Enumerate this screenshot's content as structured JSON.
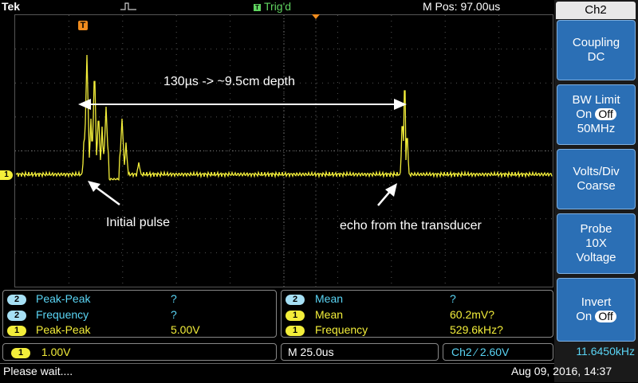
{
  "header": {
    "brand": "Tek",
    "trigger_state": "Trig'd",
    "trigger_icon_letter": "T",
    "mpos": "M Pos: 97.00us"
  },
  "menu": {
    "title": "Ch2",
    "buttons": [
      {
        "line1": "Coupling",
        "line2": "DC"
      },
      {
        "line1": "BW Limit",
        "on": "On",
        "off": "Off",
        "line3": "50MHz"
      },
      {
        "line1": "Volts/Div",
        "line2": "Coarse"
      },
      {
        "line1": "Probe",
        "line2": "10X",
        "line3": "Voltage"
      },
      {
        "line1": "Invert",
        "on": "On",
        "off": "Off"
      }
    ]
  },
  "annotations": {
    "depth": "130µs -> ~9.5cm depth",
    "initial": "Initial pulse",
    "echo": "echo from the transducer"
  },
  "channel_marker": "1",
  "trigger_marker": "T",
  "measurements_left": [
    {
      "ch": "2",
      "name": "Peak-Peak",
      "value": "?"
    },
    {
      "ch": "2",
      "name": "Frequency",
      "value": "?"
    },
    {
      "ch": "1",
      "name": "Peak-Peak",
      "value": "5.00V"
    }
  ],
  "measurements_right": [
    {
      "ch": "2",
      "name": "Mean",
      "value": "?"
    },
    {
      "ch": "1",
      "name": "Mean",
      "value": "60.2mV?"
    },
    {
      "ch": "1",
      "name": "Frequency",
      "value": "529.6kHz?"
    }
  ],
  "settings": {
    "ch1_badge": "1",
    "ch1_scale": "1.00V",
    "timebase": "M 25.0us",
    "trigger_source": "Ch2",
    "trigger_slope": "⁄",
    "trigger_level": "2.60V",
    "trigger_freq": "11.6450kHz"
  },
  "status": {
    "message": "Please wait....",
    "datetime": "Aug 09, 2016, 14:37"
  },
  "colors": {
    "trace": "#f3ee3a",
    "menu_button": "#2b6fb5",
    "trig_green": "#5fd35f",
    "trigger_marker": "#f08c1e"
  }
}
